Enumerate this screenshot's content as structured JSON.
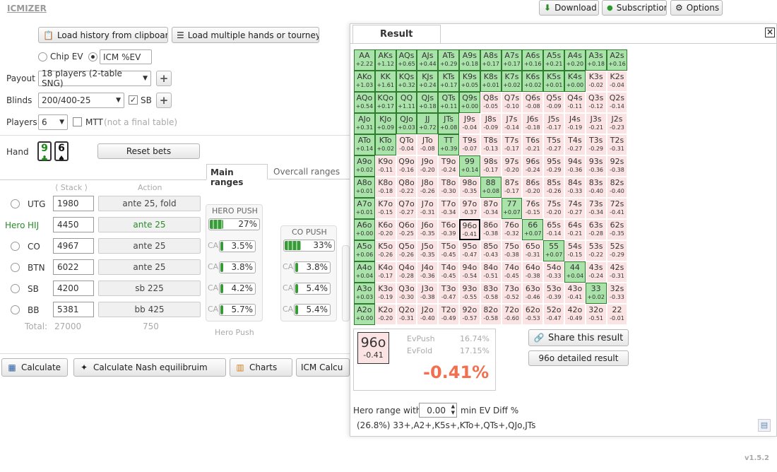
{
  "app": {
    "logo": "ICMIZER",
    "version": "v1.5.2"
  },
  "top_buttons": {
    "download": "Download",
    "subscription": "Subscription",
    "options": "Options"
  },
  "load": {
    "history": "Load history from clipboard",
    "multiple": "Load multiple hands or tourney"
  },
  "ev_mode": {
    "chip": "Chip EV",
    "icm": "ICM %EV"
  },
  "payout": {
    "label": "Payout",
    "value": "18 players (2-table SNG)"
  },
  "blinds": {
    "label": "Blinds",
    "value": "200/400-25",
    "sb_label": "SB"
  },
  "players": {
    "label": "Players",
    "value": "6",
    "mtt_label": "MTT",
    "mtt_note": "(not a final table)"
  },
  "hand": {
    "label": "Hand",
    "card1": "9",
    "card2": "6",
    "reset": "Reset bets"
  },
  "tabs": {
    "main": "Main ranges",
    "overcall": "Overcall ranges"
  },
  "table_headers": {
    "stack": "Stack",
    "action": "Action"
  },
  "seats": [
    {
      "pos": "UTG",
      "hero": "",
      "stack": "1980",
      "action": "ante 25, fold"
    },
    {
      "pos": "HIJ",
      "hero": "Hero",
      "stack": "4450",
      "action": "ante 25"
    },
    {
      "pos": "CO",
      "hero": "",
      "stack": "4967",
      "action": "ante 25"
    },
    {
      "pos": "BTN",
      "hero": "",
      "stack": "6022",
      "action": "ante 25"
    },
    {
      "pos": "SB",
      "hero": "",
      "stack": "4200",
      "action": "sb 225"
    },
    {
      "pos": "BB",
      "hero": "",
      "stack": "5381",
      "action": "bb 425"
    }
  ],
  "totals": {
    "label": "Total:",
    "stack": "27000",
    "action": "750"
  },
  "hero_push": {
    "title": "HERO PUSH",
    "value": "27%",
    "pct": 27,
    "ca_label": "CA",
    "ca": [
      "3.5%",
      "3.8%",
      "4.2%",
      "5.7%"
    ],
    "ca_pct": [
      3.5,
      3.8,
      4.2,
      5.7
    ],
    "footer": "Hero Push"
  },
  "co_push": {
    "title": "CO PUSH",
    "value": "33%",
    "pct": 33,
    "ca_label": "CA",
    "ca": [
      "3.8%",
      "5.4%",
      "5.4%"
    ],
    "ca_pct": [
      3.8,
      5.4,
      5.4
    ]
  },
  "bottom_buttons": {
    "calculate": "Calculate",
    "nash": "Calculate Nash equilibruim",
    "charts": "Charts",
    "icm": "ICM Calcu"
  },
  "result": {
    "title": "Result",
    "close": "×",
    "selected_hand": "96o",
    "selected_ev": "-0.41",
    "evpush_label": "EvPush",
    "evpush": "16.74%",
    "evfold_label": "EvFold",
    "evfold": "17.15%",
    "big_ev": "-0.41%",
    "share": "Share this result",
    "detailed": "96o detailed result",
    "hero_range_label": "Hero range with",
    "hero_range_value": "0.00",
    "hero_range_suffix": "min EV Diff %",
    "range_summary": "(26.8%) 33+,A2+,K5s+,KTo+,QTs+,QJo,JTs"
  },
  "colors": {
    "pos_fill": "#a9e3a9",
    "neg_fill": "#fbe3e3",
    "accent_red": "#f07050",
    "hero_green": "#2a8a2a"
  },
  "grid": [
    [
      "AA",
      "+2.22"
    ],
    [
      "AKs",
      "+1.12"
    ],
    [
      "AQs",
      "+0.65"
    ],
    [
      "AJs",
      "+0.44"
    ],
    [
      "ATs",
      "+0.29"
    ],
    [
      "A9s",
      "+0.18"
    ],
    [
      "A8s",
      "+0.17"
    ],
    [
      "A7s",
      "+0.17"
    ],
    [
      "A6s",
      "+0.16"
    ],
    [
      "A5s",
      "+0.21"
    ],
    [
      "A4s",
      "+0.20"
    ],
    [
      "A3s",
      "+0.18"
    ],
    [
      "A2s",
      "+0.16"
    ],
    [
      "AKo",
      "+1.03"
    ],
    [
      "KK",
      "+1.61"
    ],
    [
      "KQs",
      "+0.32"
    ],
    [
      "KJs",
      "+0.24"
    ],
    [
      "KTs",
      "+0.17"
    ],
    [
      "K9s",
      "+0.05"
    ],
    [
      "K8s",
      "+0.01"
    ],
    [
      "K7s",
      "+0.02"
    ],
    [
      "K6s",
      "+0.02"
    ],
    [
      "K5s",
      "+0.01"
    ],
    [
      "K4s",
      "+0.00"
    ],
    [
      "K3s",
      "-0.02"
    ],
    [
      "K2s",
      "-0.04"
    ],
    [
      "AQo",
      "+0.54"
    ],
    [
      "KQo",
      "+0.17"
    ],
    [
      "QQ",
      "+1.11"
    ],
    [
      "QJs",
      "+0.18"
    ],
    [
      "QTs",
      "+0.11"
    ],
    [
      "Q9s",
      "+0.00"
    ],
    [
      "Q8s",
      "-0.05"
    ],
    [
      "Q7s",
      "-0.10"
    ],
    [
      "Q6s",
      "-0.08"
    ],
    [
      "Q5s",
      "-0.09"
    ],
    [
      "Q4s",
      "-0.11"
    ],
    [
      "Q3s",
      "-0.12"
    ],
    [
      "Q2s",
      "-0.14"
    ],
    [
      "AJo",
      "+0.31"
    ],
    [
      "KJo",
      "+0.09"
    ],
    [
      "QJo",
      "+0.03"
    ],
    [
      "JJ",
      "+0.72"
    ],
    [
      "JTs",
      "+0.08"
    ],
    [
      "J9s",
      "-0.04"
    ],
    [
      "J8s",
      "-0.09"
    ],
    [
      "J7s",
      "-0.14"
    ],
    [
      "J6s",
      "-0.18"
    ],
    [
      "J5s",
      "-0.17"
    ],
    [
      "J4s",
      "-0.19"
    ],
    [
      "J3s",
      "-0.21"
    ],
    [
      "J2s",
      "-0.23"
    ],
    [
      "ATo",
      "+0.14"
    ],
    [
      "KTo",
      "+0.02"
    ],
    [
      "QTo",
      "-0.04"
    ],
    [
      "JTo",
      "-0.08"
    ],
    [
      "TT",
      "+0.39"
    ],
    [
      "T9s",
      "-0.07"
    ],
    [
      "T8s",
      "-0.13"
    ],
    [
      "T7s",
      "-0.17"
    ],
    [
      "T6s",
      "-0.21"
    ],
    [
      "T5s",
      "-0.27"
    ],
    [
      "T4s",
      "-0.27"
    ],
    [
      "T3s",
      "-0.29"
    ],
    [
      "T2s",
      "-0.31"
    ],
    [
      "A9o",
      "+0.02"
    ],
    [
      "K9o",
      "-0.11"
    ],
    [
      "Q9o",
      "-0.16"
    ],
    [
      "J9o",
      "-0.20"
    ],
    [
      "T9o",
      "-0.24"
    ],
    [
      "99",
      "+0.14"
    ],
    [
      "98s",
      "-0.17"
    ],
    [
      "97s",
      "-0.20"
    ],
    [
      "96s",
      "-0.24"
    ],
    [
      "95s",
      "-0.29"
    ],
    [
      "94s",
      "-0.36"
    ],
    [
      "93s",
      "-0.36"
    ],
    [
      "92s",
      "-0.38"
    ],
    [
      "A8o",
      "+0.01"
    ],
    [
      "K8o",
      "-0.18"
    ],
    [
      "Q8o",
      "-0.22"
    ],
    [
      "J8o",
      "-0.26"
    ],
    [
      "T8o",
      "-0.30"
    ],
    [
      "98o",
      "-0.35"
    ],
    [
      "88",
      "+0.08"
    ],
    [
      "87s",
      "-0.17"
    ],
    [
      "86s",
      "-0.20"
    ],
    [
      "85s",
      "-0.26"
    ],
    [
      "84s",
      "-0.33"
    ],
    [
      "83s",
      "-0.40"
    ],
    [
      "82s",
      "-0.40"
    ],
    [
      "A7o",
      "+0.01"
    ],
    [
      "K7o",
      "-0.15"
    ],
    [
      "Q7o",
      "-0.27"
    ],
    [
      "J7o",
      "-0.31"
    ],
    [
      "T7o",
      "-0.34"
    ],
    [
      "97o",
      "-0.37"
    ],
    [
      "87o",
      "-0.34"
    ],
    [
      "77",
      "+0.07"
    ],
    [
      "76s",
      "-0.15"
    ],
    [
      "75s",
      "-0.20"
    ],
    [
      "74s",
      "-0.27"
    ],
    [
      "73s",
      "-0.34"
    ],
    [
      "72s",
      "-0.41"
    ],
    [
      "A6o",
      "+0.00"
    ],
    [
      "K6o",
      "-0.20"
    ],
    [
      "Q6o",
      "-0.25"
    ],
    [
      "J6o",
      "-0.35"
    ],
    [
      "T6o",
      "-0.39"
    ],
    [
      "96o",
      "-0.41"
    ],
    [
      "86o",
      "-0.38"
    ],
    [
      "76o",
      "-0.32"
    ],
    [
      "66",
      "+0.07"
    ],
    [
      "65s",
      "-0.14"
    ],
    [
      "64s",
      "-0.21"
    ],
    [
      "63s",
      "-0.28"
    ],
    [
      "62s",
      "-0.35"
    ],
    [
      "A5o",
      "+0.06"
    ],
    [
      "K5o",
      "-0.26"
    ],
    [
      "Q5o",
      "-0.26"
    ],
    [
      "J5o",
      "-0.35"
    ],
    [
      "T5o",
      "-0.45"
    ],
    [
      "95o",
      "-0.47"
    ],
    [
      "85o",
      "-0.43"
    ],
    [
      "75o",
      "-0.38"
    ],
    [
      "65o",
      "-0.31"
    ],
    [
      "55",
      "+0.07"
    ],
    [
      "54s",
      "-0.15"
    ],
    [
      "53s",
      "-0.22"
    ],
    [
      "52s",
      "-0.29"
    ],
    [
      "A4o",
      "+0.04"
    ],
    [
      "K4o",
      "-0.17"
    ],
    [
      "Q4o",
      "-0.28"
    ],
    [
      "J4o",
      "-0.36"
    ],
    [
      "T4o",
      "-0.45"
    ],
    [
      "94o",
      "-0.54"
    ],
    [
      "84o",
      "-0.51"
    ],
    [
      "74o",
      "-0.45"
    ],
    [
      "64o",
      "-0.38"
    ],
    [
      "54o",
      "-0.33"
    ],
    [
      "44",
      "+0.04"
    ],
    [
      "43s",
      "-0.24"
    ],
    [
      "42s",
      "-0.31"
    ],
    [
      "A3o",
      "+0.03"
    ],
    [
      "K3o",
      "-0.19"
    ],
    [
      "Q3o",
      "-0.30"
    ],
    [
      "J3o",
      "-0.38"
    ],
    [
      "T3o",
      "-0.47"
    ],
    [
      "93o",
      "-0.55"
    ],
    [
      "83o",
      "-0.58"
    ],
    [
      "73o",
      "-0.52"
    ],
    [
      "63o",
      "-0.46"
    ],
    [
      "53o",
      "-0.39"
    ],
    [
      "43o",
      "-0.41"
    ],
    [
      "33",
      "+0.02"
    ],
    [
      "32s",
      "-0.33"
    ],
    [
      "A2o",
      "+0.00"
    ],
    [
      "K2o",
      "-0.20"
    ],
    [
      "Q2o",
      "-0.31"
    ],
    [
      "J2o",
      "-0.40"
    ],
    [
      "T2o",
      "-0.49"
    ],
    [
      "92o",
      "-0.57"
    ],
    [
      "82o",
      "-0.58"
    ],
    [
      "72o",
      "-0.60"
    ],
    [
      "62o",
      "-0.53"
    ],
    [
      "52o",
      "-0.47"
    ],
    [
      "42o",
      "-0.49"
    ],
    [
      "32o",
      "-0.51"
    ],
    [
      "22",
      "-0.01"
    ]
  ]
}
